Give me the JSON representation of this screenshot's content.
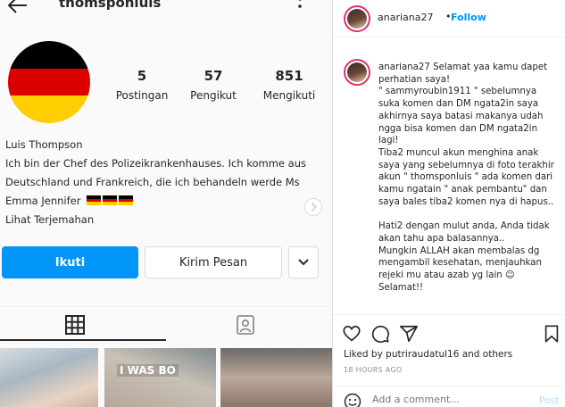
{
  "profile": {
    "username": "thomsponluis",
    "stats": [
      {
        "value": "5",
        "label": "Postingan"
      },
      {
        "value": "57",
        "label": "Pengikut"
      },
      {
        "value": "851",
        "label": "Mengikuti"
      }
    ],
    "bio": {
      "name": "Luis Thompson",
      "text": "Ich bin der Chef des Polizeikrankenhauses. Ich komme aus Deutschland und Frankreich, die ich behandeln werde Ms Emma Jennifer",
      "translate": "Lihat Terjemahan"
    },
    "buttons": {
      "follow": "Ikuti",
      "message": "Kirim Pesan"
    },
    "thumb_caption": "I WAS BO"
  },
  "post": {
    "username": "anariana27",
    "separator": "•",
    "follow": "Follow",
    "comment_user": "anariana27",
    "comment_text": "Selamat yaa kamu dapet perhatian saya!\n\" sammyroubin1911 \" sebelumnya suka komen dan DM ngata2in saya akhirnya saya batasi makanya udah ngga bisa komen dan DM ngata2in lagi!\nTiba2 muncul akun menghina anak saya yang sebelumnya di foto terakhir akun \" thomsponluis \" ada komen dari kamu ngatain \" anak pembantu\" dan saya bales tiba2 komen nya di hapus..\n\nHati2 dengan mulut anda, Anda tidak akan tahu apa balasannya..\nMungkin ALLAH akan membalas dg mengambil kesehatan, menjauhkan rejeki mu atau azab yg lain ☺\nSelamat!!",
    "liked_by": "Liked by putriraudatul16 and others",
    "timestamp": "18 HOURS AGO",
    "add_comment_placeholder": "Add a comment...",
    "post_label": "Post"
  },
  "colors": {
    "accent": "#0095f6",
    "flag_black": "#000000",
    "flag_red": "#dd0000",
    "flag_gold": "#ffce00",
    "story_ring": "#e1306c"
  },
  "icons": [
    "back-arrow-icon",
    "more-vertical-icon",
    "grid-icon",
    "tagged-icon",
    "chevron-down-icon",
    "heart-icon",
    "comment-icon",
    "share-icon",
    "bookmark-icon",
    "emoji-icon"
  ]
}
